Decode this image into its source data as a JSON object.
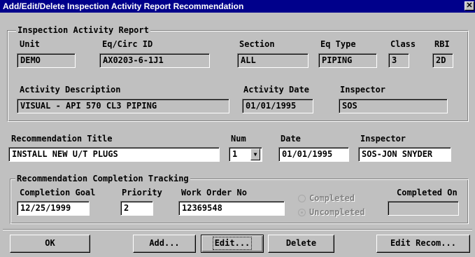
{
  "window": {
    "title": "Add/Edit/Delete Inspection Activity Report Recommendation",
    "close_glyph": "✕"
  },
  "report": {
    "legend": "Inspection Activity Report",
    "unit_label": "Unit",
    "unit_value": "DEMO",
    "eq_label": "Eq/Circ ID",
    "eq_value": "AX0203-6-1J1",
    "section_label": "Section",
    "section_value": "ALL",
    "eqtype_label": "Eq Type",
    "eqtype_value": "PIPING",
    "class_label": "Class",
    "class_value": "3",
    "rbi_label": "RBI",
    "rbi_value": "2D",
    "desc_label": "Activity Description",
    "desc_value": "VISUAL - API 570 CL3 PIPING",
    "date_label": "Activity Date",
    "date_value": "01/01/1995",
    "inspector_label": "Inspector",
    "inspector_value": "SOS"
  },
  "recommendation": {
    "title_label": "Recommendation Title",
    "title_value": "INSTALL NEW U/T PLUGS",
    "num_label": "Num",
    "num_value": "1",
    "date_label": "Date",
    "date_value": "01/01/1995",
    "inspector_label": "Inspector",
    "inspector_value": "SOS-JON SNYDER"
  },
  "tracking": {
    "legend": "Recommendation Completion Tracking",
    "goal_label": "Completion Goal",
    "goal_value": "12/25/1999",
    "priority_label": "Priority",
    "priority_value": "2",
    "workorder_label": "Work Order No",
    "workorder_value": "12369548",
    "completed_label": "Completed",
    "uncompleted_label": "Uncompleted",
    "selected": "Uncompleted",
    "completed_on_label": "Completed On",
    "completed_on_value": ""
  },
  "buttons": {
    "ok": "OK",
    "add": "Add...",
    "edit": "Edit...",
    "delete": "Delete",
    "edit_recom": "Edit Recom..."
  },
  "icons": {
    "dropdown": "chevron-down-icon"
  }
}
